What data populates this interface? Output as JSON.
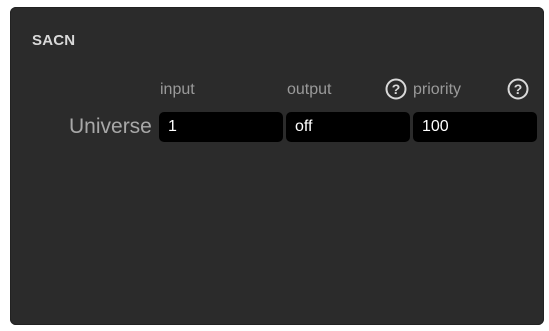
{
  "panel": {
    "title": "SACN"
  },
  "columns": {
    "input": "input",
    "output": "output",
    "priority": "priority"
  },
  "help_icons": {
    "glyph": "?",
    "color": "#d9d9d9"
  },
  "row": {
    "label": "Universe",
    "input_value": "1",
    "output_value": "off",
    "priority_value": "100"
  },
  "colors": {
    "panel_bg": "#2b2b2b",
    "field_bg": "#000000",
    "header_text": "#9a9a9a"
  }
}
